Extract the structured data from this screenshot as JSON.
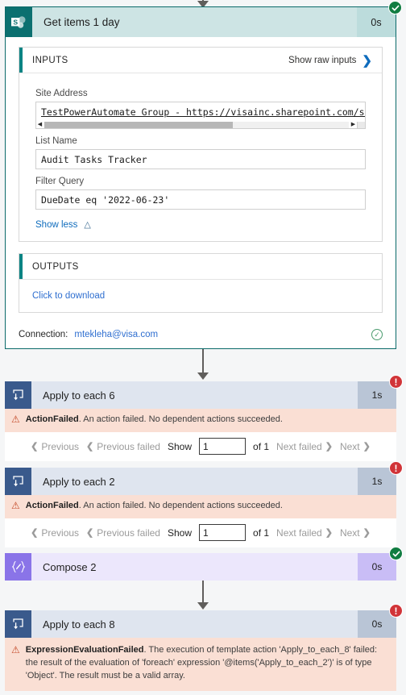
{
  "colors": {
    "sharepoint_teal": "#0b7070",
    "loop_blue": "#3a5a8c",
    "compose_purple": "#8a74e8",
    "error_red": "#d13438",
    "success_green": "#107c41",
    "link_blue": "#2f6fd0",
    "error_bg": "#fadfd4"
  },
  "sharepoint_action": {
    "title": "Get items 1 day",
    "duration": "0s",
    "status": "succeeded",
    "status_icon": "check-icon",
    "app_icon": "sharepoint-icon",
    "inputs": {
      "header": "INPUTS",
      "show_raw_label": "Show raw inputs",
      "raw_chevron_icon": "chevron-right-icon",
      "fields": [
        {
          "label": "Site Address",
          "value": "TestPowerAutomate Group - https://visainc.sharepoint.com/sites/Test",
          "has_scrollbar": true
        },
        {
          "label": "List Name",
          "value": "Audit Tasks Tracker",
          "has_scrollbar": false
        },
        {
          "label": "Filter Query",
          "value": "DueDate eq '2022-06-23'",
          "has_scrollbar": false
        }
      ],
      "show_less_label": "Show less",
      "show_less_icon": "chevron-up-icon"
    },
    "outputs": {
      "header": "OUTPUTS",
      "download_label": "Click to download"
    },
    "connection": {
      "label": "Connection:",
      "account": "mtekleha@visa.com",
      "status_icon": "check-circle-outline-icon"
    }
  },
  "actions": [
    {
      "name": "Apply to each 6",
      "duration": "1s",
      "type": "loop",
      "icon": "loop-icon",
      "status": "failed",
      "status_icon": "error-icon",
      "error": {
        "code": "ActionFailed",
        "message": "An action failed. No dependent actions succeeded.",
        "icon": "warning-icon"
      },
      "pager": {
        "previous": "Previous",
        "previous_failed": "Previous failed",
        "show": "Show",
        "value": "1",
        "of": "of 1",
        "next_failed": "Next failed",
        "next": "Next"
      }
    },
    {
      "name": "Apply to each 2",
      "duration": "1s",
      "type": "loop",
      "icon": "loop-icon",
      "status": "failed",
      "status_icon": "error-icon",
      "error": {
        "code": "ActionFailed",
        "message": "An action failed. No dependent actions succeeded.",
        "icon": "warning-icon"
      },
      "pager": {
        "previous": "Previous",
        "previous_failed": "Previous failed",
        "show": "Show",
        "value": "1",
        "of": "of 1",
        "next_failed": "Next failed",
        "next": "Next"
      }
    },
    {
      "name": "Compose 2",
      "duration": "0s",
      "type": "compose",
      "icon": "compose-icon",
      "status": "succeeded",
      "status_icon": "check-icon"
    },
    {
      "name": "Apply to each 8",
      "duration": "0s",
      "type": "loop",
      "icon": "loop-icon",
      "status": "failed",
      "status_icon": "error-icon",
      "error": {
        "code": "ExpressionEvaluationFailed",
        "message": "The execution of template action 'Apply_to_each_8' failed: the result of the evaluation of 'foreach' expression '@items('Apply_to_each_2')' is of type 'Object'. The result must be a valid array.",
        "icon": "warning-icon"
      }
    }
  ]
}
